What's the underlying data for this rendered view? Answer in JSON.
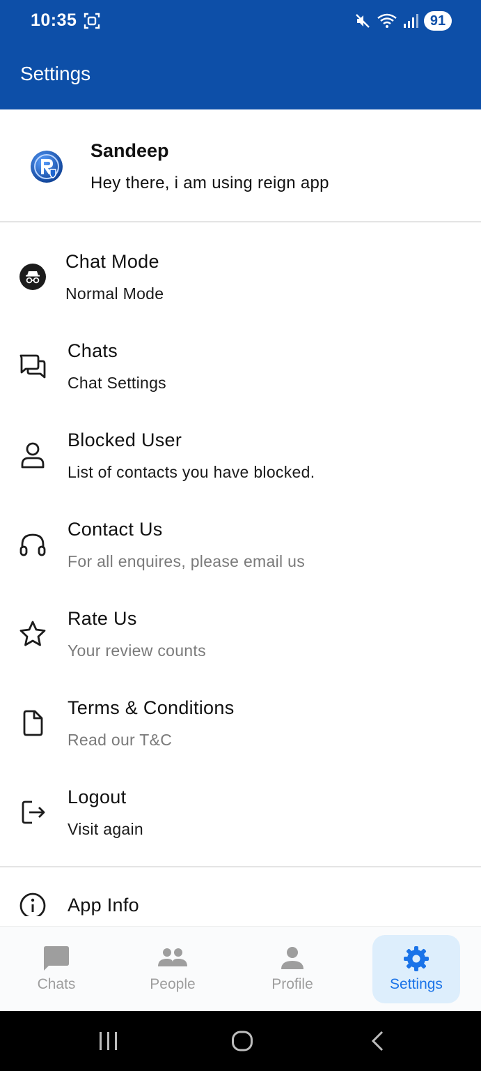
{
  "status_bar": {
    "time": "10:35",
    "battery": "91",
    "icons": [
      "screenshot-icon",
      "mute-icon",
      "wifi-icon",
      "signal-icon",
      "battery-icon"
    ]
  },
  "appbar": {
    "title": "Settings",
    "background": "#0d4fa8"
  },
  "profile": {
    "name": "Sandeep",
    "status": "Hey there, i am using reign app"
  },
  "menu": {
    "items": [
      {
        "title": "Chat Mode",
        "subtitle": "Normal Mode",
        "icon": "incognito-icon"
      },
      {
        "title": "Chats",
        "subtitle": "Chat Settings",
        "icon": "chat-bubbles-icon"
      },
      {
        "title": "Blocked User",
        "subtitle": "List of contacts you have blocked.",
        "icon": "user-outline-icon"
      },
      {
        "title": "Contact Us",
        "subtitle": "For all enquires, please email us",
        "icon": "headphones-icon"
      },
      {
        "title": "Rate Us",
        "subtitle": "Your review counts",
        "icon": "star-outline-icon"
      },
      {
        "title": "Terms & Conditions",
        "subtitle": "Read our T&C",
        "icon": "document-icon"
      },
      {
        "title": "Logout",
        "subtitle": "Visit again",
        "icon": "logout-icon"
      }
    ],
    "app_info": {
      "title": "App Info",
      "icon": "info-icon"
    }
  },
  "bottom_nav": {
    "items": [
      {
        "label": "Chats",
        "icon": "chat-icon",
        "active": false
      },
      {
        "label": "People",
        "icon": "people-icon",
        "active": false
      },
      {
        "label": "Profile",
        "icon": "person-icon",
        "active": false
      },
      {
        "label": "Settings",
        "icon": "gear-icon",
        "active": true
      }
    ],
    "active_color": "#1a73e8"
  },
  "system_nav": {
    "buttons": [
      "recents-button",
      "home-button",
      "back-button"
    ]
  }
}
